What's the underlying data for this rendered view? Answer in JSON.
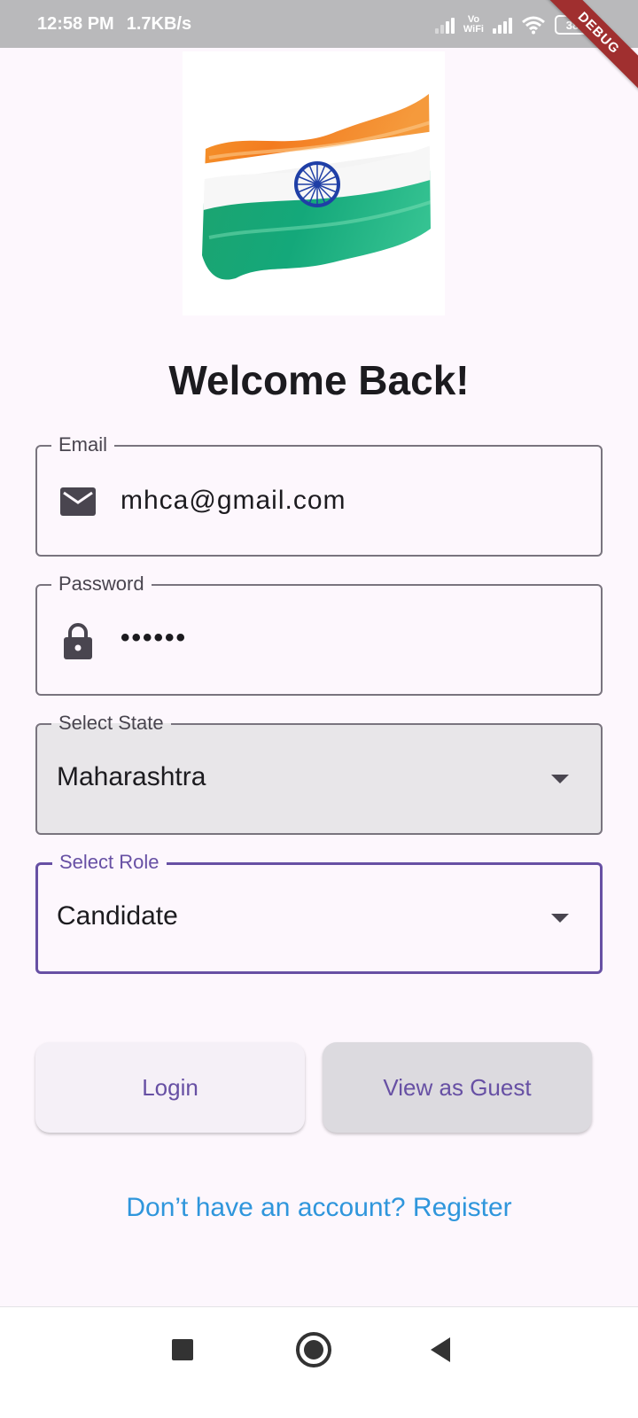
{
  "status_bar": {
    "time": "12:58 PM",
    "net_speed": "1.7KB/s",
    "vowifi_line1": "Vo",
    "vowifi_line2": "WiFi",
    "battery": "38"
  },
  "debug_banner": "DEBUG",
  "colors": {
    "background": "#fdf7fd",
    "accent": "#6750a4",
    "link": "#2f96dc",
    "filled_field": "#e8e6e9"
  },
  "title": "Welcome Back!",
  "email": {
    "label": "Email",
    "value": "mhca@gmail.com",
    "icon": "mail-icon"
  },
  "password": {
    "label": "Password",
    "value": "••••••",
    "icon": "lock-icon"
  },
  "state": {
    "label": "Select State",
    "value": "Maharashtra"
  },
  "role": {
    "label": "Select Role",
    "value": "Candidate"
  },
  "buttons": {
    "login": "Login",
    "guest": "View as Guest"
  },
  "register_link": "Don’t have an account? Register"
}
